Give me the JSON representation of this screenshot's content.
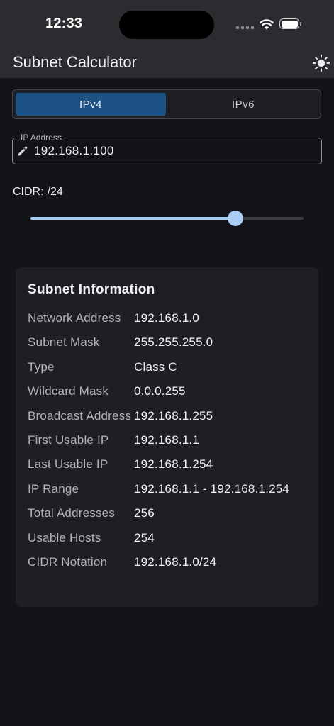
{
  "status_bar": {
    "time": "12:33",
    "icons": [
      "signal-dots-icon",
      "wifi-icon",
      "battery-icon"
    ]
  },
  "app_bar": {
    "title": "Subnet Calculator",
    "theme_icon": "sun-icon"
  },
  "ip_version": {
    "options": [
      "IPv4",
      "IPv6"
    ],
    "selected": "IPv4"
  },
  "ip_field": {
    "label": "IP Address",
    "value": "192.168.1.100",
    "icon": "pencil-icon"
  },
  "cidr": {
    "label": "CIDR:",
    "value_text": "/24",
    "value": 24,
    "min": 0,
    "max": 32
  },
  "info": {
    "title": "Subnet Information",
    "rows": [
      {
        "key": "Network Address",
        "value": "192.168.1.0"
      },
      {
        "key": "Subnet Mask",
        "value": "255.255.255.0"
      },
      {
        "key": "Type",
        "value": "Class C"
      },
      {
        "key": "Wildcard Mask",
        "value": "0.0.0.255"
      },
      {
        "key": "Broadcast Address",
        "value": "192.168.1.255"
      },
      {
        "key": "First Usable IP",
        "value": "192.168.1.1"
      },
      {
        "key": "Last Usable IP",
        "value": "192.168.1.254"
      },
      {
        "key": "IP Range",
        "value": "192.168.1.1 - 192.168.1.254"
      },
      {
        "key": "Total Addresses",
        "value": "256"
      },
      {
        "key": "Usable Hosts",
        "value": "254"
      },
      {
        "key": "CIDR Notation",
        "value": "192.168.1.0/24"
      }
    ]
  },
  "colors": {
    "background": "#121418",
    "bar": "#2a2c30",
    "accent": "#1e5184",
    "slider": "#a3c8f4",
    "card": "#1d1f23"
  }
}
